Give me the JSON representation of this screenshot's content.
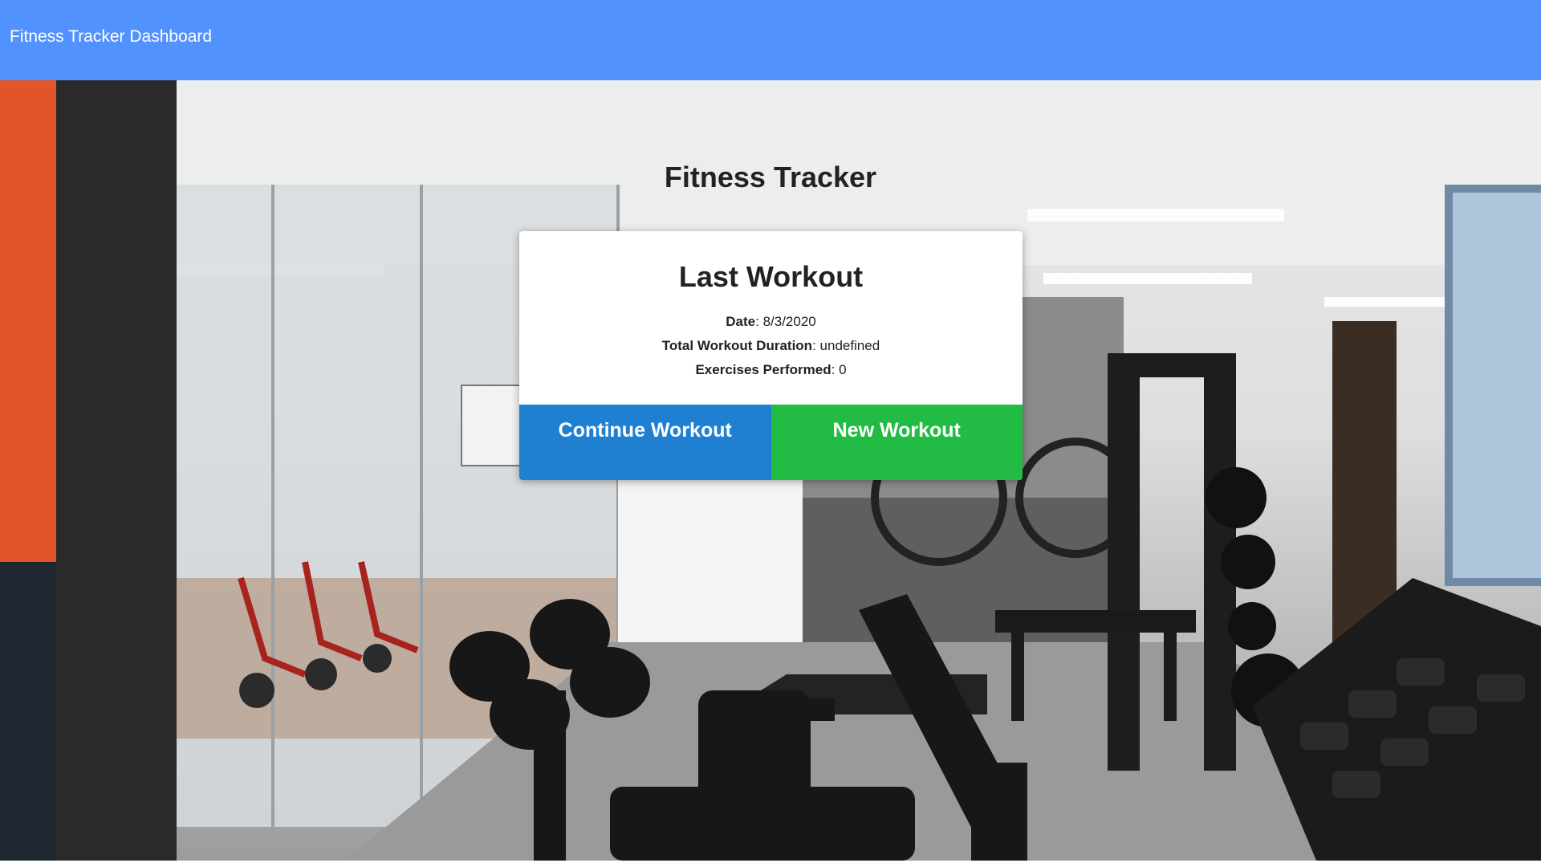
{
  "navbar": {
    "brand": "Fitness Tracker Dashboard",
    "background_color": "#5292ff"
  },
  "main": {
    "title": "Fitness Tracker"
  },
  "last_workout": {
    "title": "Last Workout",
    "date_label": "Date",
    "date_value": "8/3/2020",
    "duration_label": "Total Workout Duration",
    "duration_value": "undefined",
    "exercises_label": "Exercises Performed",
    "exercises_value": "0",
    "continue_button": "Continue Workout",
    "new_button": "New Workout",
    "continue_color": "#1f80d2",
    "new_color": "#22bb44"
  },
  "background": {
    "subject": "gym interior photo"
  }
}
